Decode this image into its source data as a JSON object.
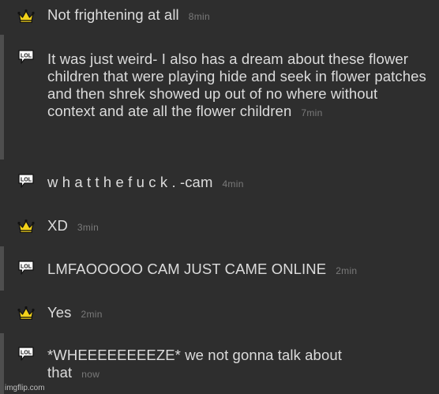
{
  "messages": [
    {
      "icon": "crown-icon",
      "type": "crown",
      "text": "Not frightening at all",
      "time": "8min"
    },
    {
      "icon": "lol-speech-bubble-icon",
      "type": "lol",
      "text": "It was just weird- I also has a dream about these flower children that were playing hide and seek in flower patches and then shrek showed up out of no where without context and ate all the flower children",
      "time": "7min"
    },
    {
      "icon": "lol-speech-bubble-icon",
      "type": "lol",
      "text": "w h a t t h e f u c k . -cam",
      "time": "4min"
    },
    {
      "icon": "crown-icon",
      "type": "crown",
      "text": "XD",
      "time": "3min"
    },
    {
      "icon": "lol-speech-bubble-icon",
      "type": "lol",
      "text": "LMFAOOOOO CAM JUST CAME ONLINE",
      "time": "2min"
    },
    {
      "icon": "crown-icon",
      "type": "crown",
      "text": "Yes",
      "time": "2min"
    },
    {
      "icon": "lol-speech-bubble-icon",
      "type": "lol",
      "text": "*WHEEEEEEEEZE* we not gonna talk about that",
      "time": "now"
    }
  ],
  "icon_labels": {
    "lol": "LOL"
  },
  "colors": {
    "background": "#2e2e2e",
    "text": "#dcdcdc",
    "timestamp": "#7a7a7a",
    "crown_fill": "#f2d21b",
    "thread_rail": "#4e4e4e"
  },
  "watermark": "imgflip.com"
}
